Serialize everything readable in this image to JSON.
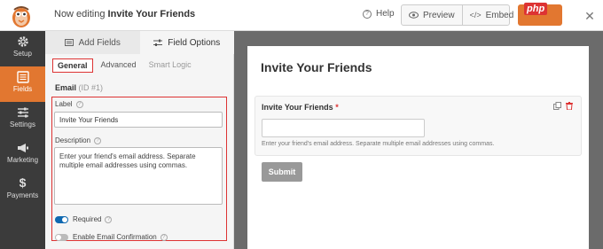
{
  "topbar": {
    "editing_prefix": "Now editing",
    "form_name": "Invite Your Friends",
    "help_label": "Help",
    "preview_label": "Preview",
    "embed_label": "Embed",
    "watermark": "php"
  },
  "sidebar": {
    "items": [
      {
        "label": "Setup",
        "icon": "gear-icon"
      },
      {
        "label": "Fields",
        "icon": "fields-list-icon",
        "active": true
      },
      {
        "label": "Settings",
        "icon": "sliders-icon"
      },
      {
        "label": "Marketing",
        "icon": "megaphone-icon"
      },
      {
        "label": "Payments",
        "icon": "dollar-icon"
      }
    ]
  },
  "panel": {
    "tabs": [
      {
        "label": "Add Fields"
      },
      {
        "label": "Field Options",
        "active": true
      }
    ],
    "subtabs": [
      {
        "label": "General",
        "active": true
      },
      {
        "label": "Advanced"
      },
      {
        "label": "Smart Logic",
        "muted": true
      }
    ],
    "section_title": "Email",
    "section_id": "(ID #1)",
    "label_caption": "Label",
    "label_value": "Invite Your Friends",
    "description_caption": "Description",
    "description_value": "Enter your friend's email address. Separate multiple email addresses using commas.",
    "required_label": "Required",
    "required_on": true,
    "confirm_label": "Enable Email Confirmation",
    "confirm_on": false
  },
  "preview": {
    "form_title": "Invite Your Friends",
    "field_label": "Invite Your Friends",
    "required_mark": "*",
    "field_description": "Enter your friend's email address. Separate multiple email addresses using commas.",
    "submit_label": "Submit"
  },
  "colors": {
    "accent": "#e27730",
    "sidebar_bg": "#3b3b3b",
    "highlight": "#dd3333",
    "toggle_on": "#0e68b0"
  }
}
